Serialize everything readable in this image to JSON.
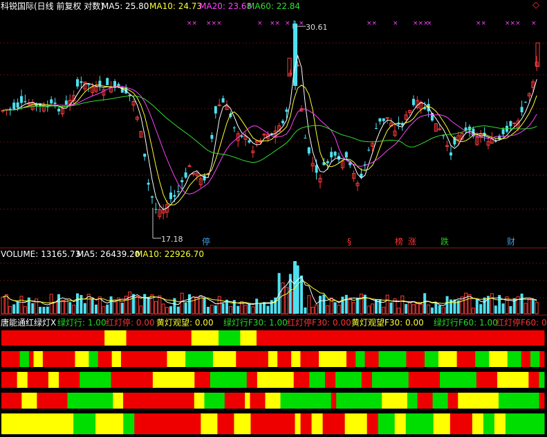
{
  "header": {
    "stock_name": "科锐国际(日线 前复权 对数)",
    "ma5": "MA5: 25.80",
    "ma10": "MA10: 24.73",
    "ma20": "MA20: 23.68",
    "ma60": "MA60: 22.84"
  },
  "annotations": {
    "high_label": "30.61",
    "low_label": "17.18",
    "markers": [
      {
        "text": "停",
        "color": "#3aa0e8"
      },
      {
        "text": "§",
        "color": "#ff3333"
      },
      {
        "text": "榜",
        "color": "#ff3333"
      },
      {
        "text": "涨",
        "color": "#ff3333"
      },
      {
        "text": "跌",
        "color": "#22cc22"
      },
      {
        "text": "财",
        "color": "#3aa0e8"
      }
    ]
  },
  "volume": {
    "label": "VOLUME: 13165.73",
    "ma5": "MA5: 26439.20",
    "ma10": "MA10: 22926.70"
  },
  "indicator": {
    "title": "唐能通红绿灯X",
    "items": [
      {
        "text": "绿灯行: 1.00",
        "color": "#22dd22"
      },
      {
        "text": "红灯停: 0.00",
        "color": "#ff3333"
      },
      {
        "text": "黄灯观望: 0.00",
        "color": "#ffff33"
      },
      {
        "text": "绿灯行F30: 1.00",
        "color": "#22dd22"
      },
      {
        "text": "红灯停F30: 0.00",
        "color": "#ff3333"
      },
      {
        "text": "黄灯观望F30: 0.00",
        "color": "#ffff33"
      },
      {
        "text": "绿灯行F60: 1.00",
        "color": "#22dd22"
      },
      {
        "text": "红灯停F60: 0",
        "color": "#ff3333"
      }
    ]
  },
  "colors": {
    "up": "#ff3b3b",
    "down": "#4fe0f0",
    "ma5": "#ffffff",
    "ma10": "#ffff33",
    "ma20": "#ff44ff",
    "ma60": "#33dd33",
    "red": "#ee0000",
    "green": "#00dd00",
    "yellow": "#ffff00"
  },
  "chart_data": {
    "type": "candlestick",
    "title": "科锐国际(日线 前复权 对数)",
    "x": [],
    "ohlc": [],
    "volume": [],
    "signal_bands": [
      [
        [
          "R",
          0.19
        ],
        [
          "Y",
          0.04
        ],
        [
          "R",
          0.12
        ],
        [
          "Y",
          0.05
        ],
        [
          "G",
          0.04
        ],
        [
          "Y",
          0.03
        ],
        [
          "R",
          0.53
        ]
      ],
      [
        [
          "R",
          0.04
        ],
        [
          "G",
          0.02
        ],
        [
          "R",
          0.01
        ],
        [
          "Y",
          0.02
        ],
        [
          "R",
          0.07
        ],
        [
          "Y",
          0.03
        ],
        [
          "G",
          0.02
        ],
        [
          "R",
          0.03
        ],
        [
          "Y",
          0.02
        ],
        [
          "R",
          0.1
        ],
        [
          "Y",
          0.04
        ],
        [
          "G",
          0.06
        ],
        [
          "Y",
          0.05
        ],
        [
          "R",
          0.06
        ],
        [
          "R",
          0.01
        ],
        [
          "Y",
          0.02
        ],
        [
          "R",
          0.03
        ],
        [
          "Y",
          0.02
        ],
        [
          "R",
          0.04
        ],
        [
          "Y",
          0.06
        ],
        [
          "R",
          0.02
        ],
        [
          "G",
          0.02
        ],
        [
          "R",
          0.03
        ],
        [
          "G",
          0.06
        ],
        [
          "R",
          0.03
        ],
        [
          "R",
          0.01
        ],
        [
          "G",
          0.03
        ],
        [
          "Y",
          0.04
        ],
        [
          "R",
          0.04
        ],
        [
          "G",
          0.03
        ],
        [
          "Y",
          0.04
        ],
        [
          "G",
          0.03
        ],
        [
          "R",
          0.02
        ],
        [
          "G",
          0.02
        ],
        [
          "R",
          0.01
        ]
      ],
      [
        [
          "R",
          0.03
        ],
        [
          "Y",
          0.02
        ],
        [
          "R",
          0.04
        ],
        [
          "Y",
          0.02
        ],
        [
          "R",
          0.04
        ],
        [
          "G",
          0.06
        ],
        [
          "R",
          0.05
        ],
        [
          "R",
          0.03
        ],
        [
          "Y",
          0.08
        ],
        [
          "R",
          0.03
        ],
        [
          "G",
          0.07
        ],
        [
          "R",
          0.02
        ],
        [
          "Y",
          0.07
        ],
        [
          "R",
          0.03
        ],
        [
          "G",
          0.03
        ],
        [
          "R",
          0.02
        ],
        [
          "G",
          0.05
        ],
        [
          "R",
          0.02
        ],
        [
          "G",
          0.07
        ],
        [
          "R",
          0.06
        ],
        [
          "G",
          0.05
        ],
        [
          "G",
          0.02
        ],
        [
          "R",
          0.04
        ],
        [
          "Y",
          0.06
        ],
        [
          "R",
          0.02
        ],
        [
          "G",
          0.01
        ]
      ],
      [
        [
          "R",
          0.04
        ],
        [
          "Y",
          0.03
        ],
        [
          "R",
          0.06
        ],
        [
          "G",
          0.09
        ],
        [
          "Y",
          0.02
        ],
        [
          "R",
          0.14
        ],
        [
          "Y",
          0.02
        ],
        [
          "G",
          0.04
        ],
        [
          "R",
          0.04
        ],
        [
          "Y",
          0.01
        ],
        [
          "R",
          0.03
        ],
        [
          "Y",
          0.03
        ],
        [
          "G",
          0.1
        ],
        [
          "R",
          0.01
        ],
        [
          "G",
          0.09
        ],
        [
          "Y",
          0.05
        ],
        [
          "G",
          0.02
        ],
        [
          "R",
          0.03
        ],
        [
          "G",
          0.03
        ],
        [
          "R",
          0.02
        ],
        [
          "Y",
          0.08
        ],
        [
          "G",
          0.08
        ],
        [
          "R",
          0.01
        ]
      ],
      [
        [
          "Y",
          0.13
        ],
        [
          "G",
          0.04
        ],
        [
          "Y",
          0.05
        ],
        [
          "G",
          0.02
        ],
        [
          "R",
          0.12
        ],
        [
          "Y",
          0.03
        ],
        [
          "R",
          0.03
        ],
        [
          "Y",
          0.03
        ],
        [
          "R",
          0.08
        ],
        [
          "Y",
          0.01
        ],
        [
          "R",
          0.02
        ],
        [
          "Y",
          0.02
        ],
        [
          "R",
          0.04
        ],
        [
          "Y",
          0.04
        ],
        [
          "R",
          0.02
        ],
        [
          "G",
          0.03
        ],
        [
          "Y",
          0.02
        ],
        [
          "G",
          0.05
        ],
        [
          "Y",
          0.03
        ],
        [
          "R",
          0.04
        ],
        [
          "Y",
          0.02
        ],
        [
          "G",
          0.02
        ],
        [
          "Y",
          0.02
        ],
        [
          "G",
          0.07
        ]
      ]
    ]
  }
}
